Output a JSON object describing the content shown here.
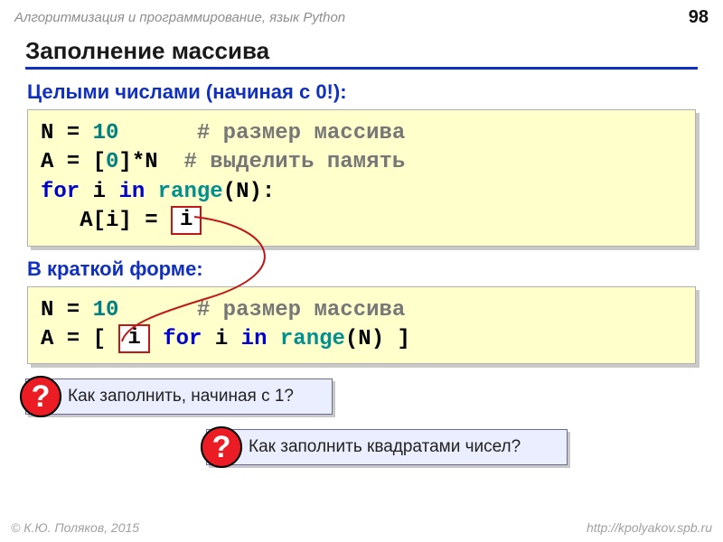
{
  "header": {
    "breadcrumb": "Алгоритмизация и программирование, язык Python",
    "page": "98"
  },
  "title": "Заполнение массива",
  "subtitles": {
    "integers": "Целыми числами (начиная с 0!):",
    "short_form": "В краткой форме:"
  },
  "code1": {
    "n_var": "N",
    "eq": " = ",
    "n_val": "10",
    "c1": "# размер массива",
    "a_init": "A = [",
    "zero": "0",
    "a_tail": "]*N",
    "c2": "# выделить память",
    "for_kw": "for",
    "i": "i",
    "in_kw": "in",
    "range_fn": "range",
    "range_arg": "(N):",
    "assign": "   A[i] = ",
    "var_box": "i"
  },
  "code2": {
    "n_var": "N",
    "eq": " = ",
    "n_val": "10",
    "c1": "# размер массива",
    "a_open": "A = [ ",
    "var_box": "i",
    "for_kw": "for",
    "i": " i ",
    "in_kw": "in",
    "range_fn": "range",
    "range_arg": "(N) ]"
  },
  "questions": {
    "q1": "Как заполнить, начиная с 1?",
    "q2": "Как заполнить квадратами чисел?"
  },
  "footer": {
    "author": "© К.Ю. Поляков, 2015",
    "url": "http://kpolyakov.spb.ru"
  }
}
